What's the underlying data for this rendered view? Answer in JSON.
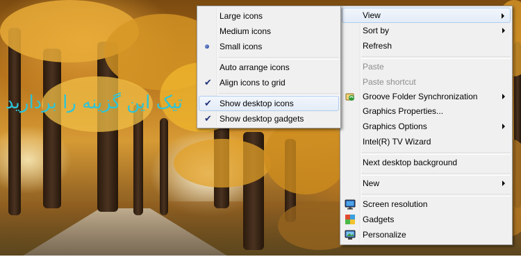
{
  "annotation": {
    "text": "تیک این گزینه را بردارید"
  },
  "main_menu": {
    "items": [
      {
        "label": "View"
      },
      {
        "label": "Sort by"
      },
      {
        "label": "Refresh"
      },
      {
        "label": "Paste"
      },
      {
        "label": "Paste shortcut"
      },
      {
        "label": "Groove Folder Synchronization"
      },
      {
        "label": "Graphics Properties..."
      },
      {
        "label": "Graphics Options"
      },
      {
        "label": "Intel(R) TV Wizard"
      },
      {
        "label": "Next desktop background"
      },
      {
        "label": "New"
      },
      {
        "label": "Screen resolution"
      },
      {
        "label": "Gadgets"
      },
      {
        "label": "Personalize"
      }
    ]
  },
  "view_submenu": {
    "items": [
      {
        "label": "Large icons"
      },
      {
        "label": "Medium icons"
      },
      {
        "label": "Small icons",
        "selected": true
      },
      {
        "label": "Auto arrange icons",
        "checked": false
      },
      {
        "label": "Align icons to grid",
        "checked": true
      },
      {
        "label": "Show desktop icons",
        "checked": true
      },
      {
        "label": "Show desktop gadgets",
        "checked": true
      }
    ]
  },
  "icons": {
    "small_icons_mark": "radio-bullet-icon",
    "checkmark": "checkmark-icon",
    "groove": "groove-sync-icon",
    "screen_resolution": "monitor-icon",
    "gadgets": "gadgets-icon",
    "personalize": "personalize-icon"
  },
  "colors": {
    "annotation_text": "#2ec4d6",
    "menu_bg": "#f0f0f0",
    "highlight_border": "#aeccee"
  }
}
